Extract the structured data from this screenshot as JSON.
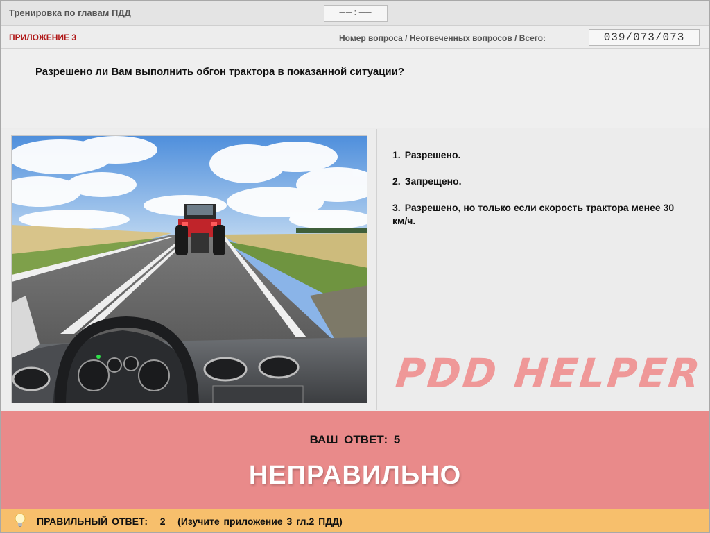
{
  "header": {
    "title": "Тренировка по главам ПДД",
    "timer": "——:——"
  },
  "infobar": {
    "section": "ПРИЛОЖЕНИЕ 3",
    "counter_label": "Номер вопроса / Неотвеченных вопросов / Всего:",
    "counter_value": "039/073/073"
  },
  "question": {
    "text": "Разрешено ли Вам выполнить обгон трактора в показанной ситуации?"
  },
  "answers": [
    {
      "number": "1.",
      "text": "Разрешено."
    },
    {
      "number": "2.",
      "text": "Запрещено."
    },
    {
      "number": "3.",
      "text": "Разрешено, но только если скорость трактора менее 30 км/ч."
    }
  ],
  "watermark": "PDD HELPER",
  "result": {
    "your_answer_label": "ВАШ ОТВЕТ:",
    "your_answer_value": "5",
    "verdict": "НЕПРАВИЛЬНО",
    "color": "#e98a8a"
  },
  "footer": {
    "icon": "lightbulb-icon",
    "correct_label": "ПРАВИЛЬНЫЙ ОТВЕТ:",
    "correct_value": "2",
    "hint": "(Изучите приложение 3 гл.2 ПДД)",
    "color": "#f7bf6c"
  }
}
